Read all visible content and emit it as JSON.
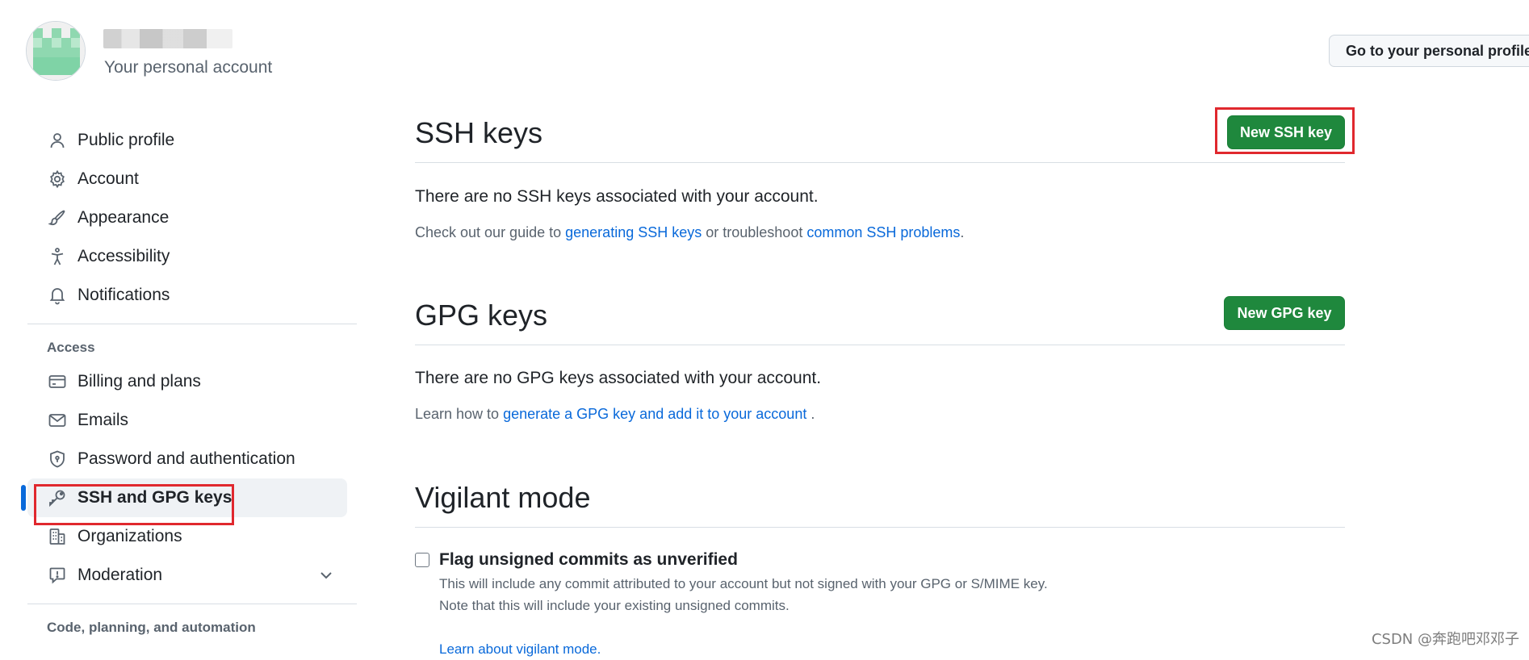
{
  "header": {
    "account_subtitle": "Your personal account",
    "profile_button": "Go to your personal profile"
  },
  "sidebar": {
    "items": [
      {
        "label": "Public profile",
        "icon": "person-icon"
      },
      {
        "label": "Account",
        "icon": "gear-icon"
      },
      {
        "label": "Appearance",
        "icon": "paintbrush-icon"
      },
      {
        "label": "Accessibility",
        "icon": "accessibility-icon"
      },
      {
        "label": "Notifications",
        "icon": "bell-icon"
      }
    ],
    "access_label": "Access",
    "access_items": [
      {
        "label": "Billing and plans",
        "icon": "credit-card-icon"
      },
      {
        "label": "Emails",
        "icon": "mail-icon"
      },
      {
        "label": "Password and authentication",
        "icon": "shield-lock-icon"
      },
      {
        "label": "SSH and GPG keys",
        "icon": "key-icon",
        "active": true
      },
      {
        "label": "Organizations",
        "icon": "organization-icon"
      },
      {
        "label": "Moderation",
        "icon": "report-icon"
      }
    ],
    "code_label": "Code, planning, and automation"
  },
  "ssh": {
    "title": "SSH keys",
    "button": "New SSH key",
    "empty": "There are no SSH keys associated with your account.",
    "help_prefix": "Check out our guide to",
    "help_link1": "generating SSH keys",
    "help_middle": "or troubleshoot",
    "help_link2": "common SSH problems",
    "help_suffix": "."
  },
  "gpg": {
    "title": "GPG keys",
    "button": "New GPG key",
    "empty": "There are no GPG keys associated with your account.",
    "help_prefix": "Learn how to",
    "help_link": "generate a GPG key and add it to your account",
    "help_suffix": "."
  },
  "vigilant": {
    "title": "Vigilant mode",
    "checkbox_label": "Flag unsigned commits as unverified",
    "desc_line1": "This will include any commit attributed to your account but not signed with your GPG or S/MIME key.",
    "desc_line2": "Note that this will include your existing unsigned commits.",
    "learn_link": "Learn about vigilant mode."
  },
  "watermark": "CSDN @奔跑吧邓邓子",
  "colors": {
    "accent": "#0969da",
    "green_button": "#1f883d",
    "highlight_box": "#e0282e"
  }
}
